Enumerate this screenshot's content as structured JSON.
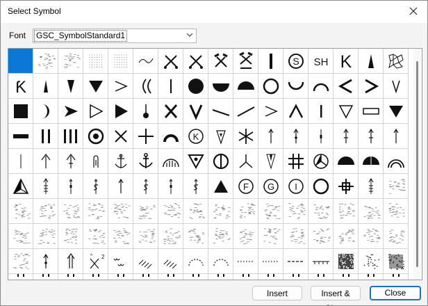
{
  "window": {
    "title": "Select Symbol"
  },
  "font": {
    "label": "Font",
    "value": "GSC_SymbolStandard1"
  },
  "buttons": {
    "insert": "Insert",
    "insert_close": "Insert & Close",
    "close": "Close"
  },
  "grid": {
    "selected_index": 0,
    "rows": [
      [
        "blank",
        "pattern-speckle",
        "pattern-speckle",
        "pattern-dots-light",
        "pattern-dots-light",
        "wave-line",
        "crossed-picks-dots",
        "crossed-picks-dots",
        "hammer-cross",
        "hammer-cross-base",
        "vertical-bar",
        "circled-S",
        "SH",
        "K",
        "wedge-up",
        "polygon-net"
      ],
      [
        "T-hook",
        "wedge-up-thin",
        "wedge-down",
        "triangle-down-filled",
        "chevron-right-thin",
        "double-paren",
        "vertical-bar-thin",
        "filled-circle",
        "half-disk-down",
        "half-disk-up",
        "open-circle",
        "arc-cup",
        "arc-cap",
        "chevron-left",
        "chevron-right",
        "v-thin"
      ],
      [
        "filled-square",
        "crescent",
        "arrowhead-right",
        "triangle-right-open",
        "triangle-right-filled",
        "pin-dot",
        "X",
        "V",
        "slash-tilted",
        "slash-dash",
        "chevron-right-thin",
        "caret-up",
        "short-bar",
        "triangle-down-open",
        "rectangle-open",
        "triangle-down-filled"
      ],
      [
        "dash-bar",
        "double-bar",
        "triple-bar",
        "circle-dot",
        "X-thin",
        "plus",
        "arc-horseshoe",
        "circled-K",
        "shield-down",
        "asterisk",
        "arrow-up-thin",
        "arrow-up-dot",
        "line-tick",
        "arrow-up-tick",
        "arrow-up-tick",
        "arrow-up-thin"
      ],
      [
        "line-thin",
        "arrow-up-open",
        "arrow-up-open-tick",
        "paperclip-loop",
        "anchor-open",
        "anchor",
        "arch-ticks",
        "triangle-down-circle",
        "circle-line",
        "fork",
        "arrowhead-down-long",
        "hash",
        "peace",
        "half-disk-up",
        "half-disk-split",
        "arch-double"
      ],
      [
        "triangle-star",
        "arrow-ticks",
        "arrow-dot-line",
        "dollar-arrow",
        "arrow-up-thin",
        "dollar-arrow",
        "arrow-dot-line",
        "dollar-arrow",
        "triangle-up-filled",
        "circled-F",
        "circled-G",
        "circled-I",
        "open-circle",
        "plus-boxed",
        "arrow-ticks",
        "pattern-speckle"
      ],
      [
        "pattern-speckle",
        "pattern-speckle",
        "pattern-speckle",
        "pattern-speckle",
        "pattern-speckle",
        "pattern-speckle",
        "pattern-speckle",
        "pattern-speckle",
        "pattern-speckle",
        "pattern-speckle",
        "pattern-speckle",
        "pattern-speckle",
        "pattern-speckle",
        "pattern-speckle",
        "pattern-speckle",
        "pattern-speckle"
      ],
      [
        "pattern-speckle",
        "pattern-speckle",
        "pattern-speckle",
        "pattern-speckle",
        "pattern-speckle",
        "pattern-speckle",
        "pattern-speckle",
        "pattern-speckle",
        "pattern-speckle",
        "pattern-speckle",
        "pattern-speckle",
        "pattern-speckle",
        "pattern-speckle",
        "pattern-speckle",
        "pattern-speckle",
        "pattern-speckle"
      ],
      [
        "pattern-speckle",
        "arrow-up-dot",
        "arrow-up-double",
        "cross-superscript",
        "squiggle-lines",
        "diagonal-strokes",
        "diagonal-strokes",
        "dashed-arc",
        "dashed-arc",
        "dotted-line",
        "dotted-line",
        "dashed-line",
        "tick-line",
        "pattern-dense-noise",
        "pattern-scattered-dots",
        "pattern-scattered-blobs"
      ],
      [
        "partial",
        "partial",
        "partial",
        "partial",
        "partial",
        "partial",
        "partial",
        "partial",
        "partial",
        "partial",
        "partial",
        "partial",
        "partial",
        "partial",
        "partial",
        "partial"
      ]
    ]
  }
}
